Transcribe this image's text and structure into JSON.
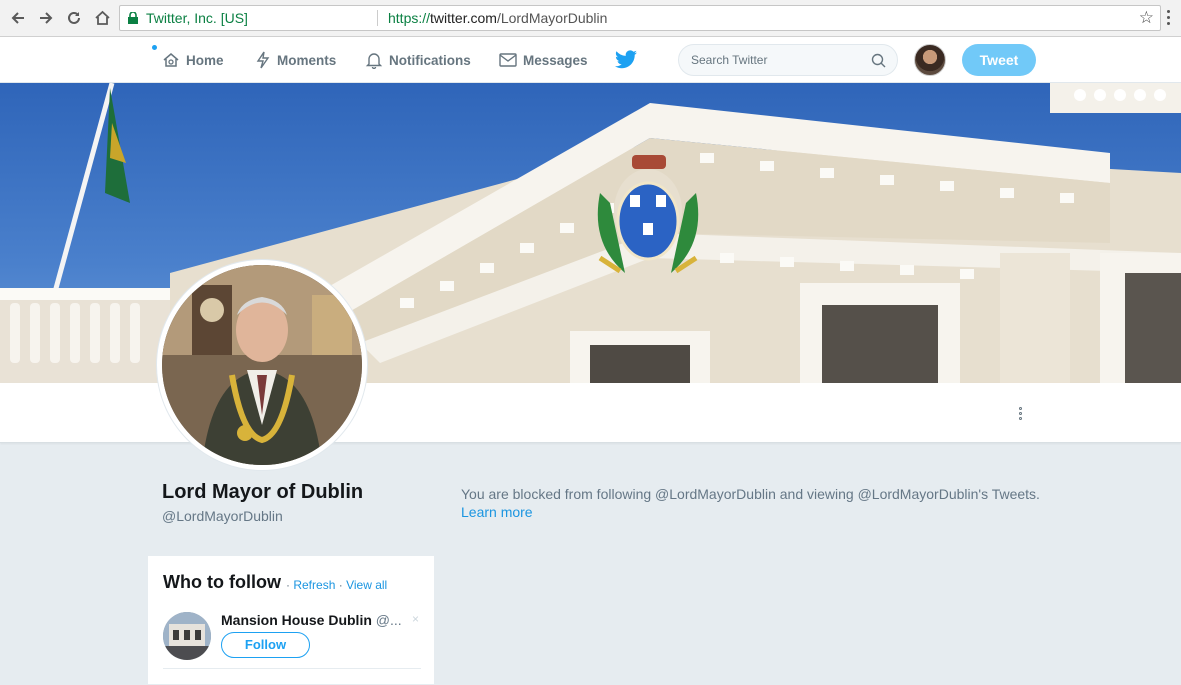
{
  "browser": {
    "org_label": "Twitter, Inc. [US]",
    "url_scheme": "https://",
    "url_host": "twitter.com",
    "url_path": "/LordMayorDublin",
    "icons": [
      "back-arrow-icon",
      "forward-arrow-icon",
      "reload-icon",
      "home-icon",
      "lock-icon",
      "star-icon",
      "menu-icon"
    ]
  },
  "topnav": {
    "home": "Home",
    "moments": "Moments",
    "notifications": "Notifications",
    "messages": "Messages",
    "search_placeholder": "Search Twitter",
    "tweet_button": "Tweet"
  },
  "profile": {
    "name": "Lord Mayor of Dublin",
    "handle": "@LordMayorDublin",
    "blocked_message": "You are blocked from following @LordMayorDublin and viewing @LordMayorDublin's Tweets.",
    "learn_more": "Learn more"
  },
  "who_to_follow": {
    "title": "Who to follow",
    "separator": "·",
    "refresh": "Refresh",
    "view_all": "View all",
    "suggestions": [
      {
        "name": "Mansion House Dublin",
        "handle": "@...",
        "follow_label": "Follow",
        "dismiss": "×"
      }
    ]
  },
  "colors": {
    "accent": "#1da1f2",
    "background": "#e6ecf0",
    "secure_green": "#0b8043"
  }
}
